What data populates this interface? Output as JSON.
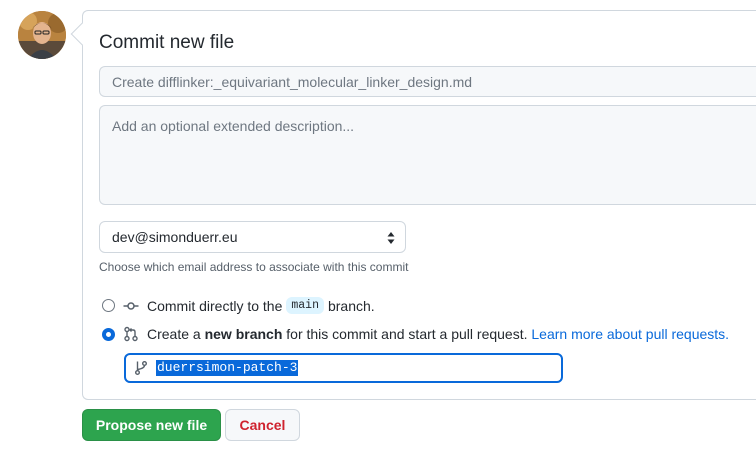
{
  "form": {
    "title": "Commit new file",
    "summary_placeholder": "Create difflinker:_equivariant_molecular_linker_design.md",
    "description_placeholder": "Add an optional extended description...",
    "email": {
      "selected": "dev@simonduerr.eu",
      "hint": "Choose which email address to associate with this commit"
    },
    "options": {
      "direct": {
        "prefix": "Commit directly to the",
        "branch": "main",
        "suffix": "branch.",
        "checked": false
      },
      "new_branch": {
        "prefix": "Create a",
        "bold": "new branch",
        "suffix": "for this commit and start a pull request.",
        "link": "Learn more about pull requests.",
        "checked": true
      }
    },
    "branch_name": "duerrsimon-patch-3",
    "propose_label": "Propose new file",
    "cancel_label": "Cancel"
  },
  "colors": {
    "primary": "#2da44e",
    "accent": "#0969da",
    "danger": "#cf222e"
  },
  "icons": {
    "avatar": "user-avatar",
    "direct_commit": "git-commit-icon",
    "pull_request": "git-pull-request-icon",
    "branch": "git-branch-icon",
    "select_arrows": "chevron-up-down-icon"
  }
}
